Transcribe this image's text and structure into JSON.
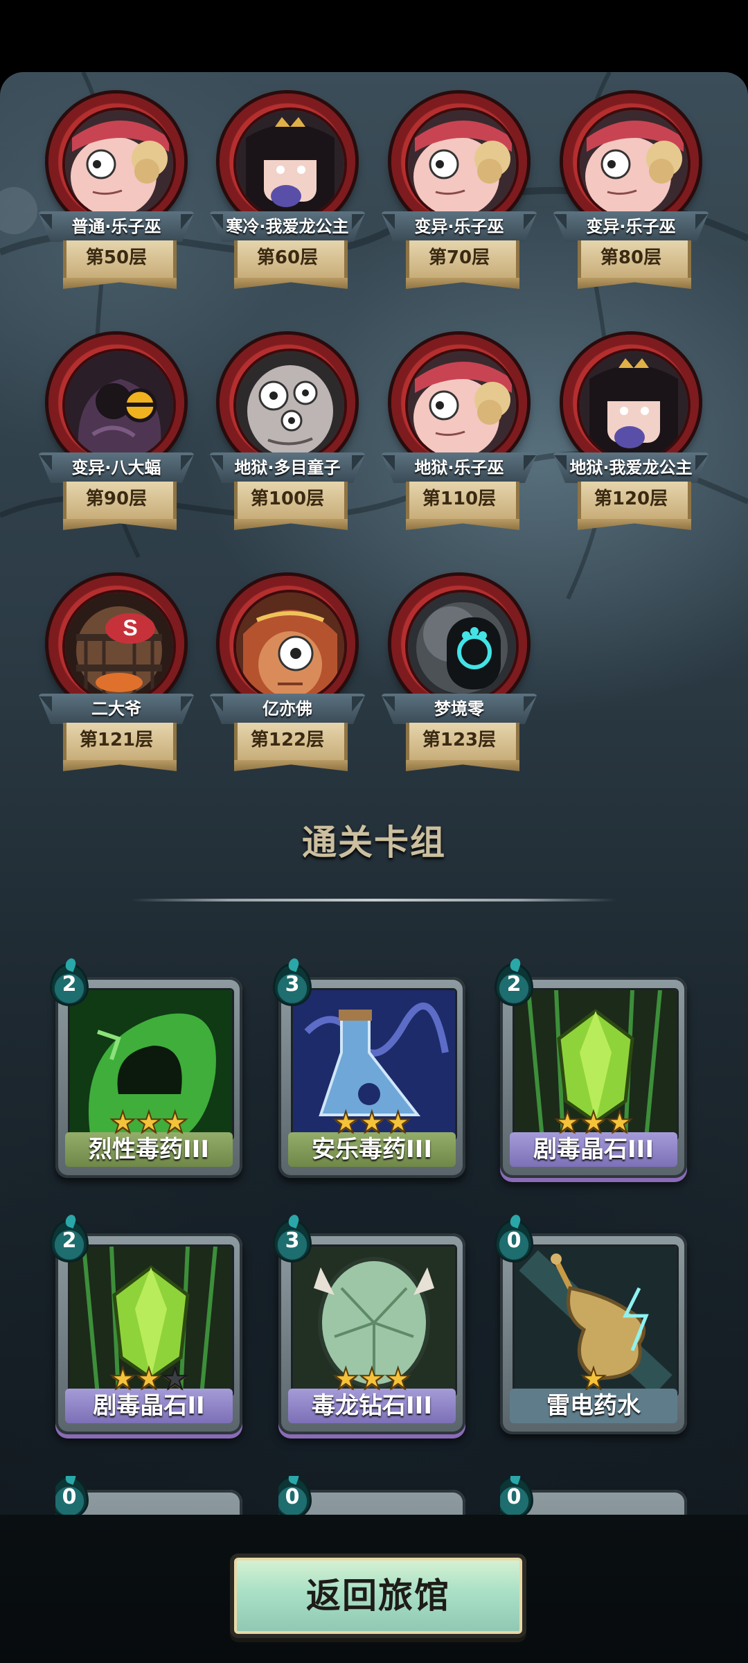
{
  "bosses": [
    {
      "name": "普通·乐子巫",
      "floor": "第50层",
      "icon": "jester-witch-portrait"
    },
    {
      "name": "寒冷·我爱龙公主",
      "floor": "第60层",
      "icon": "dragon-princess-portrait"
    },
    {
      "name": "变异·乐子巫",
      "floor": "第70层",
      "icon": "jester-witch-portrait"
    },
    {
      "name": "变异·乐子巫",
      "floor": "第80层",
      "icon": "jester-witch-portrait"
    },
    {
      "name": "变异·八大蝠",
      "floor": "第90层",
      "icon": "bat-portrait"
    },
    {
      "name": "地狱·多目童子",
      "floor": "第100层",
      "icon": "many-eyed-child-portrait"
    },
    {
      "name": "地狱·乐子巫",
      "floor": "第110层",
      "icon": "jester-witch-portrait"
    },
    {
      "name": "地狱·我爱龙公主",
      "floor": "第120层",
      "icon": "dragon-princess-portrait"
    },
    {
      "name": "二大爷",
      "floor": "第121层",
      "icon": "barrel-portrait"
    },
    {
      "name": "亿亦佛",
      "floor": "第122层",
      "icon": "one-eye-buddha-portrait"
    },
    {
      "name": "梦境零",
      "floor": "第123层",
      "icon": "dream-zero-portrait"
    }
  ],
  "section_title": "通关卡组",
  "cards": [
    {
      "name": "烈性毒药III",
      "cost": "2",
      "stars": 3,
      "max_stars": 3,
      "label_color": "#7f9a56",
      "icon": "green-poison-flask-icon"
    },
    {
      "name": "安乐毒药III",
      "cost": "3",
      "stars": 3,
      "max_stars": 3,
      "label_color": "#7f9a56",
      "icon": "blue-poison-bottle-icon"
    },
    {
      "name": "剧毒晶石III",
      "cost": "2",
      "stars": 3,
      "max_stars": 3,
      "label_color": "#8f84c6",
      "icon": "green-crystal-icon"
    },
    {
      "name": "剧毒晶石II",
      "cost": "2",
      "stars": 2,
      "max_stars": 3,
      "label_color": "#8f84c6",
      "icon": "green-crystal-icon"
    },
    {
      "name": "毒龙钻石III",
      "cost": "3",
      "stars": 3,
      "max_stars": 3,
      "label_color": "#8f84c6",
      "icon": "dragon-diamond-icon"
    },
    {
      "name": "雷电药水",
      "cost": "0",
      "stars": 1,
      "max_stars": 1,
      "label_color": "#5f7c8a",
      "icon": "thunder-potion-icon"
    }
  ],
  "partial_cards": [
    {
      "cost": "0"
    },
    {
      "cost": "0"
    },
    {
      "cost": "0"
    }
  ],
  "return_button": {
    "label": "返回旅馆"
  }
}
